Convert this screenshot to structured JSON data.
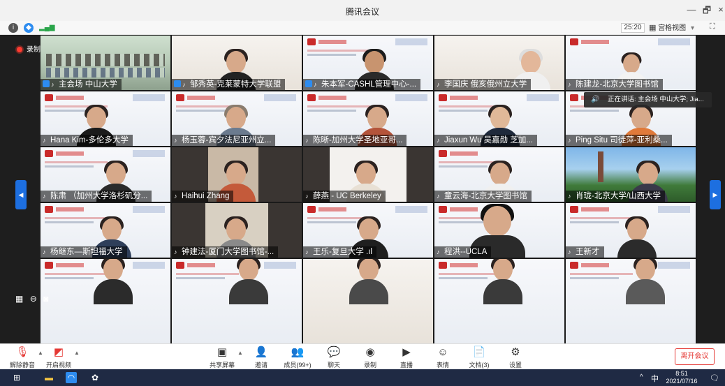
{
  "window": {
    "title": "腾讯会议",
    "controls": [
      "—",
      "🗗",
      "×"
    ]
  },
  "subbar": {
    "timer": "25:20",
    "view_label": "宫格视图",
    "view_caret": "▾"
  },
  "recording": {
    "label": "录制中"
  },
  "speaking": {
    "text": "正在讲话: 主会场 中山大学; Jia..."
  },
  "tiles": [
    {
      "name": "主会场 中山大学",
      "host": true
    },
    {
      "name": "邹秀英-克莱蒙特大学联盟",
      "host": true
    },
    {
      "name": "朱本军-CASHL管理中心-...",
      "host": true
    },
    {
      "name": "李国庆 俄亥俄州立大学",
      "host": false
    },
    {
      "name": "陈建龙-北京大学图书馆",
      "host": false
    },
    {
      "name": "Hana Kim-多伦多大学",
      "host": false
    },
    {
      "name": "杨玉蓉-宾夕法尼亚州立...",
      "host": false
    },
    {
      "name": "陈晰-加州大学圣地亚哥...",
      "host": false
    },
    {
      "name": "Jiaxun Wu 吴嘉勋 芝加...",
      "host": false
    },
    {
      "name": "Ping Situ 司徒萍-亚利桑...",
      "host": false
    },
    {
      "name": "陈肃 （加州大学洛杉矶分...",
      "host": false
    },
    {
      "name": "Haihui Zhang",
      "host": false
    },
    {
      "name": "薛燕 - UC Berkeley",
      "host": false
    },
    {
      "name": "童云海-北京大学图书馆",
      "host": false
    },
    {
      "name": "肖珑-北京大学/山西大学",
      "host": false
    },
    {
      "name": "杨继东—斯坦福大学",
      "host": false
    },
    {
      "name": "钟建法-厦门大学图书馆-...",
      "host": false
    },
    {
      "name": "王乐-复旦大学 .ıl",
      "host": false
    },
    {
      "name": "程洪--UCLA",
      "host": false
    },
    {
      "name": "王新才",
      "host": false
    },
    {
      "name": "",
      "host": false
    },
    {
      "name": "",
      "host": false
    },
    {
      "name": "",
      "host": false
    },
    {
      "name": "",
      "host": false
    },
    {
      "name": "",
      "host": false
    }
  ],
  "toolbar": {
    "unmute": "解除静音",
    "video": "开启视频",
    "share": "共享屏幕",
    "invite": "邀请",
    "members": "成员(99+)",
    "chat": "聊天",
    "record": "录制",
    "live": "直播",
    "reactions": "表情",
    "docs": "文档(3)",
    "settings": "设置",
    "leave": "离开会议"
  },
  "taskbar": {
    "ime": "中",
    "tray_caret": "^",
    "time": "8:51",
    "date": "2021/07/16"
  }
}
